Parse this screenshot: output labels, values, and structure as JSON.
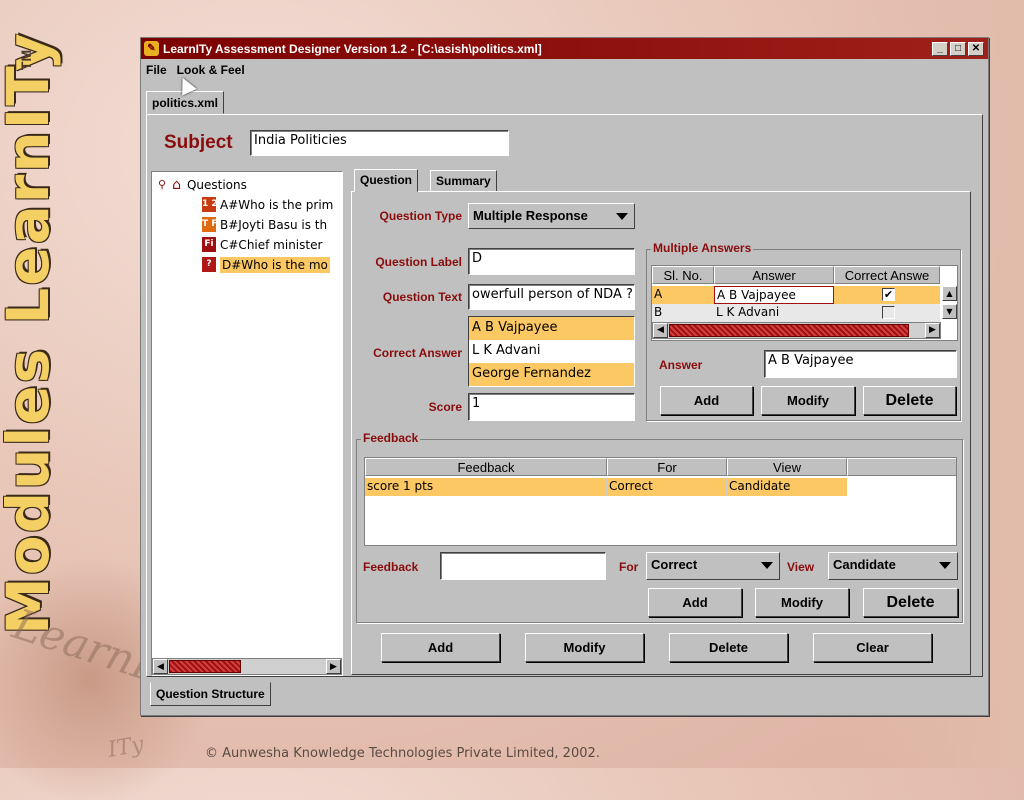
{
  "branding": {
    "side_title": "Modules LearnITy",
    "tm": "TM",
    "watermark_1": "LearnITy",
    "watermark_2": "ITy",
    "footer": "© Aunwesha Knowledge Technologies Private Limited,  2002."
  },
  "window": {
    "title": "LearnITy Assessment Designer Version 1.2 - [C:\\asish\\politics.xml]",
    "controls": [
      "_",
      "□",
      "✕"
    ]
  },
  "menu": [
    "File",
    "Look & Feel"
  ],
  "file_tab": "politics.xml",
  "subject": {
    "label": "Subject",
    "value": "India Politicies"
  },
  "tree": {
    "root": "Questions",
    "items": [
      {
        "icon": "ordering-icon",
        "icon_text": "1 2",
        "text": "A#Who is the prim",
        "selected": false
      },
      {
        "icon": "true-false-icon",
        "icon_text": "T F",
        "text": "B#Joyti Basu is th",
        "selected": false
      },
      {
        "icon": "fill-in-blank-icon",
        "icon_text": "Fi",
        "text": "C#Chief minister",
        "selected": false
      },
      {
        "icon": "multiple-response-icon",
        "icon_text": "?",
        "text": "D#Who is the mo",
        "selected": true
      }
    ]
  },
  "tabs": {
    "question": "Question",
    "summary": "Summary"
  },
  "question": {
    "type_label": "Question Type",
    "type_value": "Multiple Response",
    "label_label": "Question Label",
    "label_value": "D",
    "text_label": "Question Text",
    "text_value": "owerfull person of NDA ?",
    "correct_label": "Correct Answer",
    "correct_options": [
      {
        "text": "A B Vajpayee",
        "selected": true
      },
      {
        "text": "L K Advani",
        "selected": false
      },
      {
        "text": "George Fernandez",
        "selected": true
      }
    ],
    "score_label": "Score",
    "score_value": "1"
  },
  "multiple_answers": {
    "title": "Multiple Answers",
    "columns": [
      "Sl. No.",
      "Answer",
      "Correct Answe"
    ],
    "rows": [
      {
        "sl": "A",
        "answer": "A B Vajpayee",
        "correct": "✔",
        "selected": true
      },
      {
        "sl": "B",
        "answer": "L K Advani",
        "correct": "",
        "selected": false
      }
    ],
    "answer_label": "Answer",
    "answer_value": "A B Vajpayee",
    "buttons": {
      "add": "Add",
      "modify": "Modify",
      "delete": "Delete"
    }
  },
  "feedback": {
    "title": "Feedback",
    "columns": [
      "Feedback",
      "For",
      "View"
    ],
    "rows": [
      {
        "feedback": "score 1 pts",
        "for": "Correct",
        "view": "Candidate"
      }
    ],
    "feedback_label": "Feedback",
    "feedback_value": "",
    "for_label": "For",
    "for_value": "Correct",
    "view_label": "View",
    "view_value": "Candidate",
    "buttons": {
      "add": "Add",
      "modify": "Modify",
      "delete": "Delete"
    }
  },
  "bottom_buttons": {
    "add": "Add",
    "modify": "Modify",
    "delete": "Delete",
    "clear": "Clear"
  },
  "bottom_tab": "Question Structure",
  "colors": {
    "titlebar": "#7b0000",
    "label_red": "#8a0c0c",
    "selection": "#fcc864",
    "panel": "#c0c0c0"
  }
}
